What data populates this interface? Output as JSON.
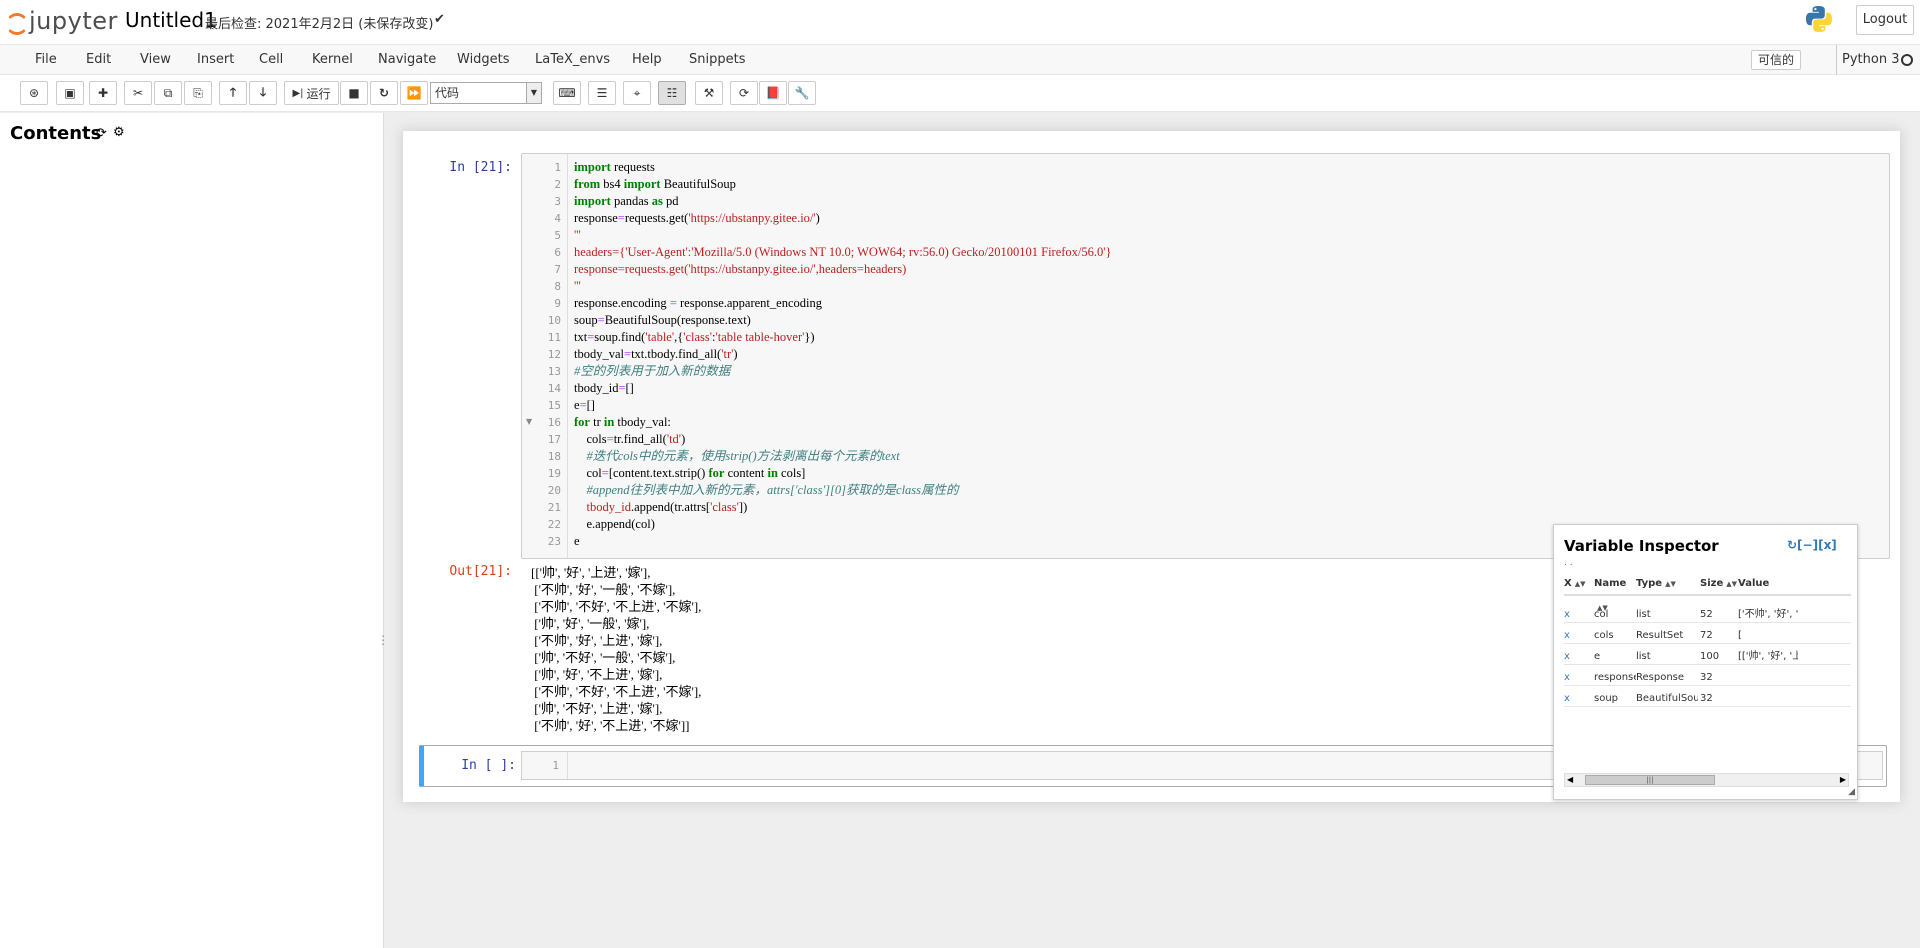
{
  "header": {
    "logo_text": "jupyter",
    "notebook_name": "Untitled1",
    "save_status": "最后检查: 2021年2月2日   (未保存改变)",
    "logout_label": "Logout"
  },
  "menubar": {
    "items": [
      "File",
      "Edit",
      "View",
      "Insert",
      "Cell",
      "Kernel",
      "Navigate",
      "Widgets",
      "LaTeX_envs",
      "Help",
      "Snippets"
    ],
    "trusted_label": "可信的",
    "kernel_name": "Python 3"
  },
  "toolbar": {
    "run_label": "运行",
    "cell_type": "代码"
  },
  "toc": {
    "title": "Contents"
  },
  "cell1": {
    "in_prompt": "In  [21]:",
    "out_prompt": "Out[21]:",
    "line_numbers": [
      "1",
      "2",
      "3",
      "4",
      "5",
      "6",
      "7",
      "8",
      "9",
      "10",
      "11",
      "12",
      "13",
      "14",
      "15",
      "16",
      "17",
      "18",
      "19",
      "20",
      "21",
      "22",
      "23"
    ],
    "output_lines": [
      "[['帅', '好', '上进', '嫁'],",
      " ['不帅', '好', '一般', '不嫁'],",
      " ['不帅', '不好', '不上进', '不嫁'],",
      " ['帅', '好', '一般', '嫁'],",
      " ['不帅', '好', '上进', '嫁'],",
      " ['帅', '不好', '一般', '不嫁'],",
      " ['帅', '好', '不上进', '嫁'],",
      " ['不帅', '不好', '不上进', '不嫁'],",
      " ['帅', '不好', '上进', '嫁'],",
      " ['不帅', '好', '不上进', '不嫁']]"
    ]
  },
  "cell2": {
    "in_prompt": "In  [  ]:",
    "line_number": "1"
  },
  "inspector": {
    "title": "Variable Inspector",
    "controls": "↻[−][x]",
    "dots": ". .",
    "headers": [
      "X",
      "Name",
      "Type",
      "Size",
      "Value"
    ],
    "rows": [
      {
        "x": "x",
        "name": "col",
        "type": "list",
        "size": "52",
        "value": "['不帅', '好', '不..."
      },
      {
        "x": "x",
        "name": "cols",
        "type": "ResultSet",
        "size": "72",
        "value": "["
      },
      {
        "x": "x",
        "name": "e",
        "type": "list",
        "size": "100",
        "value": "[['帅', '好', '上进"
      },
      {
        "x": "x",
        "name": "response",
        "type": "Response",
        "size": "32",
        "value": ""
      },
      {
        "x": "x",
        "name": "soup",
        "type": "BeautifulSoup",
        "size": "32",
        "value": ""
      }
    ]
  }
}
